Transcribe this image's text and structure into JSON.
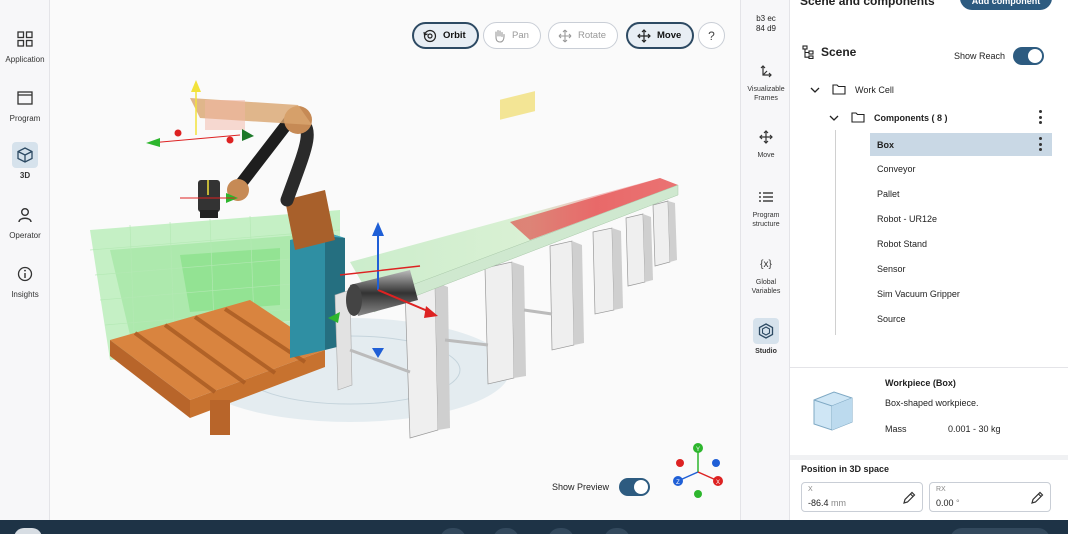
{
  "left_nav": [
    {
      "label": "Application",
      "icon": "grid-icon"
    },
    {
      "label": "Program",
      "icon": "window-icon"
    },
    {
      "label": "3D",
      "icon": "cube-icon",
      "active": true
    },
    {
      "label": "Operator",
      "icon": "person-icon"
    },
    {
      "label": "Insights",
      "icon": "info-icon"
    }
  ],
  "viewport": {
    "modes": [
      {
        "label": "Orbit",
        "icon": "orbit-icon",
        "active": true
      },
      {
        "label": "Pan",
        "icon": "hand-icon",
        "active": false
      },
      {
        "label": "Rotate",
        "icon": "rotate-icon",
        "active": false
      },
      {
        "label": "Move",
        "icon": "move-icon",
        "active": true
      }
    ],
    "help_label": "?",
    "show_preview_label": "Show Preview",
    "show_preview_on": true
  },
  "toolstrip": {
    "id_text": [
      "b3 ec",
      "84 d9"
    ],
    "tools": [
      {
        "label": [
          "Visualizable",
          "Frames"
        ],
        "icon": "frames-icon"
      },
      {
        "label": [
          "Move"
        ],
        "icon": "move-arrows-icon"
      },
      {
        "label": [
          "Program",
          "structure"
        ],
        "icon": "list-icon"
      },
      {
        "label": [
          "Global",
          "Variables"
        ],
        "icon": "variables-icon"
      },
      {
        "label": [
          "Studio"
        ],
        "icon": "hexagon-icon",
        "active": true
      }
    ],
    "variables_glyph": "{x}"
  },
  "panel": {
    "header_title": "Scene and components",
    "add_button": "Add component",
    "scene_title": "Scene",
    "show_reach_label": "Show Reach",
    "show_reach_on": true,
    "tree": {
      "root": "Work Cell",
      "group": "Components ( 8 )",
      "items": [
        "Box",
        "Conveyor",
        "Pallet",
        "Robot - UR12e",
        "Robot Stand",
        "Sensor",
        "Sim Vacuum Gripper",
        "Source"
      ],
      "selected": "Box"
    },
    "workpiece": {
      "title": "Workpiece (Box)",
      "description": "Box-shaped workpiece.",
      "mass_label": "Mass",
      "mass_value": "0.001 - 30 kg"
    },
    "position": {
      "title": "Position in 3D space",
      "fields": [
        {
          "label": "X",
          "value": "-86.4",
          "unit": "mm"
        },
        {
          "label": "RX",
          "value": "0.00",
          "unit": "°"
        }
      ]
    }
  },
  "colors": {
    "accent": "#2d5b80",
    "active_border": "#2d4a63",
    "selected_row": "#c9d8e5",
    "bottom_bar": "#1e3346"
  }
}
